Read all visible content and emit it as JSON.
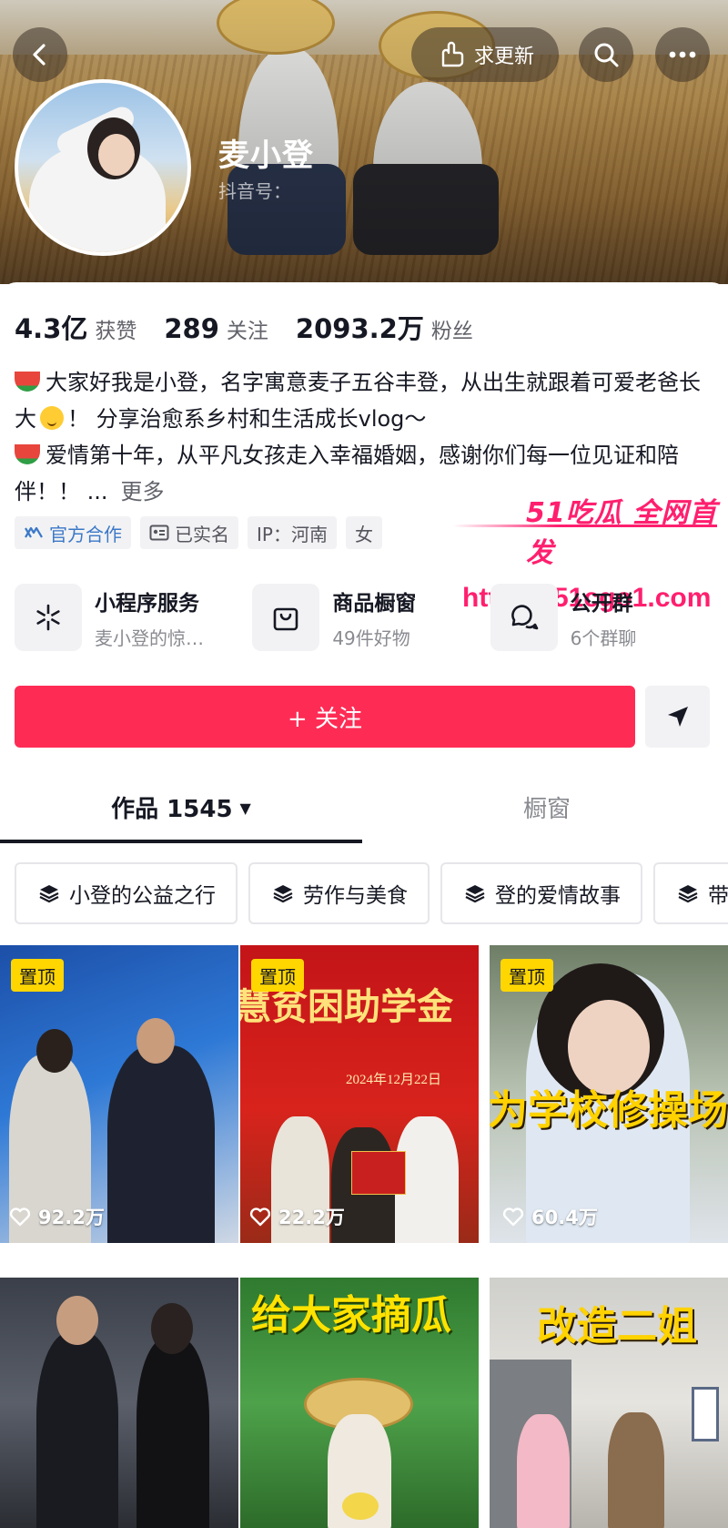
{
  "header": {
    "nickname": "麦小登",
    "douyin_id_label": "抖音号：",
    "update_request_label": "求更新"
  },
  "stats": [
    {
      "value": "4.3亿",
      "label": "获赞"
    },
    {
      "value": "289",
      "label": "关注"
    },
    {
      "value": "2093.2万",
      "label": "粉丝"
    }
  ],
  "bio": {
    "line1": "大家好我是小登，名字寓意麦子五谷丰登，从出生就跟着可爱老爸长大",
    "line1_end": "！ 分享治愈系乡村和生活成长vlog～",
    "line2": "爱情第十年，从平凡女孩走入幸福婚姻，感谢你们每一位见证和陪伴！！ ...",
    "more": "更多"
  },
  "tags": [
    {
      "label": "官方合作",
      "icon": "official-cooperation-icon"
    },
    {
      "label": "已实名",
      "icon": "id-card-icon"
    },
    {
      "label": "IP：河南"
    },
    {
      "label": "女"
    }
  ],
  "watermark": {
    "top": "51吃瓜 全网首发",
    "url": "https://51cgo1.com"
  },
  "services": [
    {
      "title": "小程序服务",
      "subtitle": "麦小登的惊…",
      "icon": "mini-program-icon"
    },
    {
      "title": "商品橱窗",
      "subtitle": "49件好物",
      "icon": "shopping-bag-icon"
    },
    {
      "title": "公开群",
      "subtitle": "6个群聊",
      "icon": "group-chat-icon"
    }
  ],
  "actions": {
    "follow_label": "+ 关注",
    "share_icon": "send-icon"
  },
  "tabs": {
    "works_label": "作品 1545",
    "window_label": "橱窗"
  },
  "collections": [
    {
      "label": "小登的公益之行"
    },
    {
      "label": "劳作与美食"
    },
    {
      "label": "登的爱情故事"
    },
    {
      "label": "带"
    }
  ],
  "videos": [
    {
      "pinned": "置顶",
      "likes": "92.2万"
    },
    {
      "pinned": "置顶",
      "likes": "22.2万",
      "caption": "慧贫困助学金",
      "date": "2024年12月22日"
    },
    {
      "pinned": "置顶",
      "likes": "60.4万",
      "caption": "为学校修操场"
    },
    {
      "caption": ""
    },
    {
      "caption": "给大家摘瓜"
    },
    {
      "caption": "改造二姐"
    }
  ],
  "colors": {
    "accent": "#fe2c55",
    "pin": "#ffd600",
    "watermark": "#ff1f6e"
  }
}
